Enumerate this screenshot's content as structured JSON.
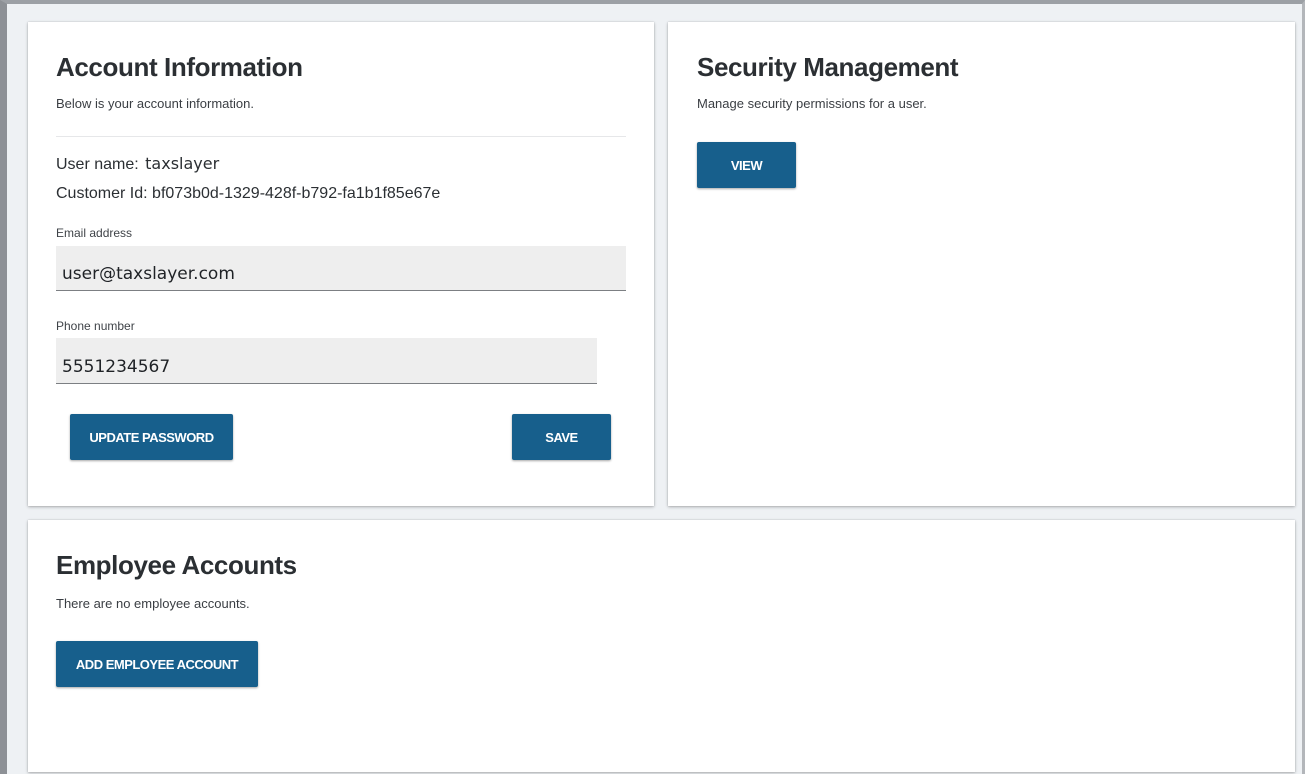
{
  "account": {
    "title": "Account Information",
    "subtitle": "Below is your account information.",
    "username_label": "User name:",
    "username_value": "taxslayer",
    "customer_id_label": "Customer Id:",
    "customer_id_value": "bf073b0d-1329-428f-b792-fa1b1f85e67e",
    "email_label": "Email address",
    "email_value": "user@taxslayer.com",
    "phone_label": "Phone number",
    "phone_value": "5551234567",
    "update_password_label": "UPDATE PASSWORD",
    "save_label": "SAVE"
  },
  "security": {
    "title": "Security Management",
    "subtitle": "Manage security permissions for a user.",
    "view_label": "VIEW"
  },
  "employees": {
    "title": "Employee Accounts",
    "subtitle": "There are no employee accounts.",
    "add_label": "ADD EMPLOYEE ACCOUNT"
  },
  "colors": {
    "button": "#175f8c",
    "card": "#ffffff",
    "field": "#eeeeee"
  }
}
